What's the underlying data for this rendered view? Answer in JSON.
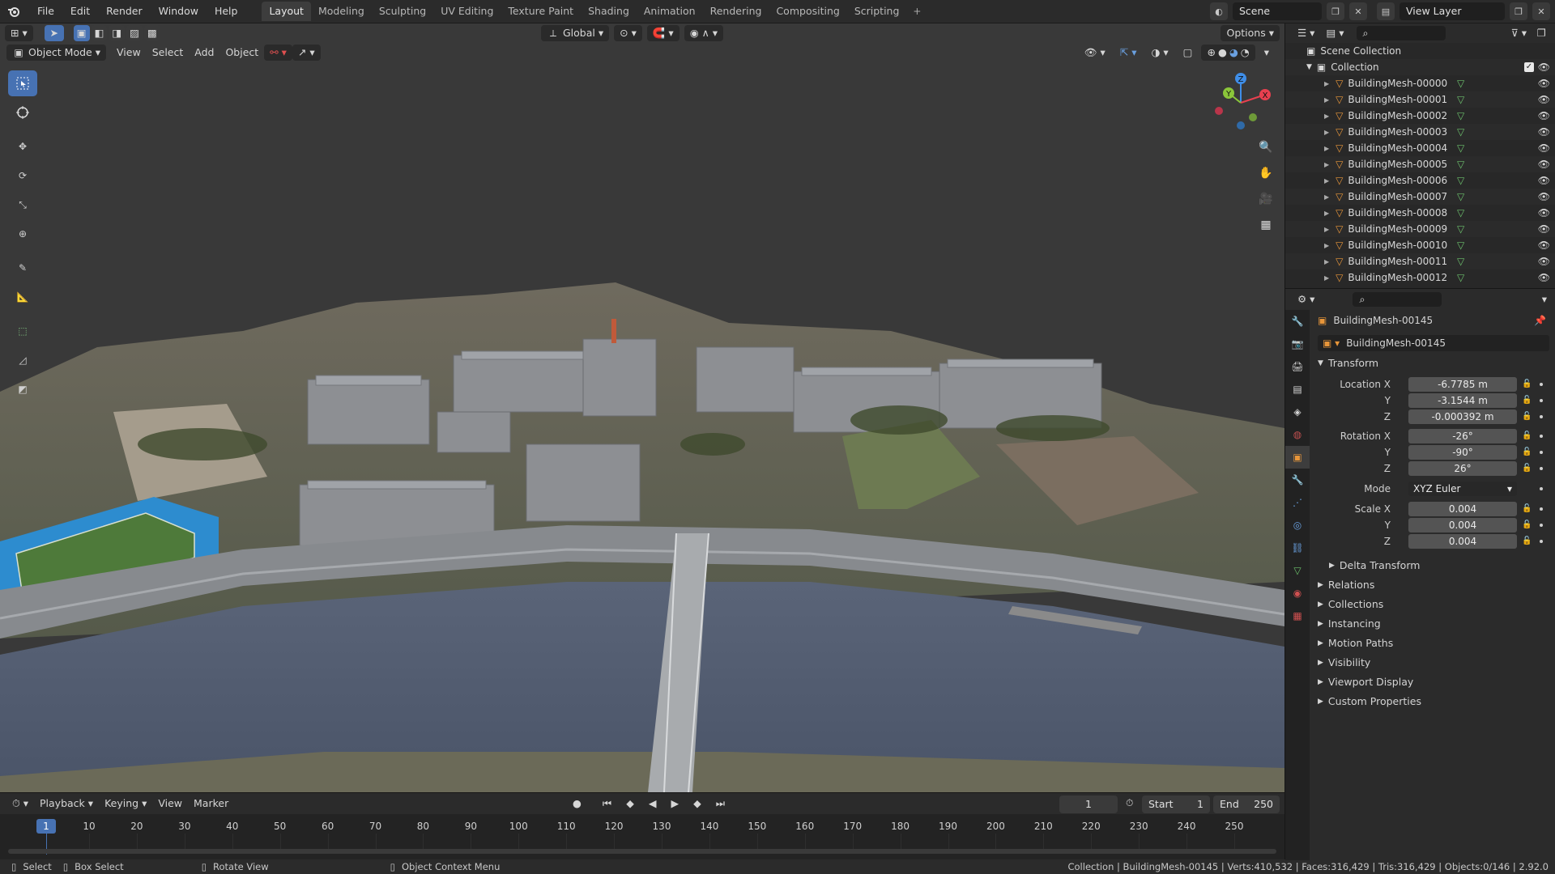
{
  "topbar": {
    "menus": [
      "File",
      "Edit",
      "Render",
      "Window",
      "Help"
    ],
    "workspaces": [
      "Layout",
      "Modeling",
      "Sculpting",
      "UV Editing",
      "Texture Paint",
      "Shading",
      "Animation",
      "Rendering",
      "Compositing",
      "Scripting"
    ],
    "active_workspace": "Layout",
    "add_icon": "plus-icon",
    "scene_label": "Scene",
    "view_layer_label": "View Layer"
  },
  "viewport": {
    "mode": "Object Mode",
    "menus": [
      "View",
      "Select",
      "Add",
      "Object"
    ],
    "transform_orientation": "Global",
    "options_label": "Options"
  },
  "timeline": {
    "menus": [
      "Playback",
      "Keying",
      "View",
      "Marker"
    ],
    "current_frame": "1",
    "start_label": "Start",
    "start_value": "1",
    "end_label": "End",
    "end_value": "250",
    "ticks": [
      "1",
      "10",
      "20",
      "30",
      "40",
      "50",
      "60",
      "70",
      "80",
      "90",
      "100",
      "110",
      "120",
      "130",
      "140",
      "150",
      "160",
      "170",
      "180",
      "190",
      "200",
      "210",
      "220",
      "230",
      "240",
      "250"
    ]
  },
  "status": {
    "select": "Select",
    "box_select": "Box Select",
    "rotate_view": "Rotate View",
    "context_menu": "Object Context Menu",
    "stats": "Collection | BuildingMesh-00145 | Verts:410,532 | Faces:316,429 | Tris:316,429 | Objects:0/146 | 2.92.0"
  },
  "outliner": {
    "scene_collection": "Scene Collection",
    "collection": "Collection",
    "items": [
      "BuildingMesh-00000",
      "BuildingMesh-00001",
      "BuildingMesh-00002",
      "BuildingMesh-00003",
      "BuildingMesh-00004",
      "BuildingMesh-00005",
      "BuildingMesh-00006",
      "BuildingMesh-00007",
      "BuildingMesh-00008",
      "BuildingMesh-00009",
      "BuildingMesh-00010",
      "BuildingMesh-00011",
      "BuildingMesh-00012"
    ]
  },
  "properties": {
    "object_name": "BuildingMesh-00145",
    "datablock_name": "BuildingMesh-00145",
    "transform_label": "Transform",
    "location_label": "Location X",
    "rotation_label": "Rotation X",
    "scale_label": "Scale X",
    "mode_label": "Mode",
    "y_label": "Y",
    "z_label": "Z",
    "location": [
      "-6.7785 m",
      "-3.1544 m",
      "-0.000392 m"
    ],
    "rotation": [
      "-26°",
      "-90°",
      "26°"
    ],
    "mode": "XYZ Euler",
    "scale": [
      "0.004",
      "0.004",
      "0.004"
    ],
    "delta_transform": "Delta Transform",
    "sections": [
      "Relations",
      "Collections",
      "Instancing",
      "Motion Paths",
      "Visibility",
      "Viewport Display",
      "Custom Properties"
    ]
  },
  "colors": {
    "accent": "#4772b3",
    "mesh_orange": "#e8963a",
    "mesh_green": "#6cc06c",
    "axis_x": "#e8404f",
    "axis_y": "#8bc63a",
    "axis_z": "#3f8ee8"
  }
}
